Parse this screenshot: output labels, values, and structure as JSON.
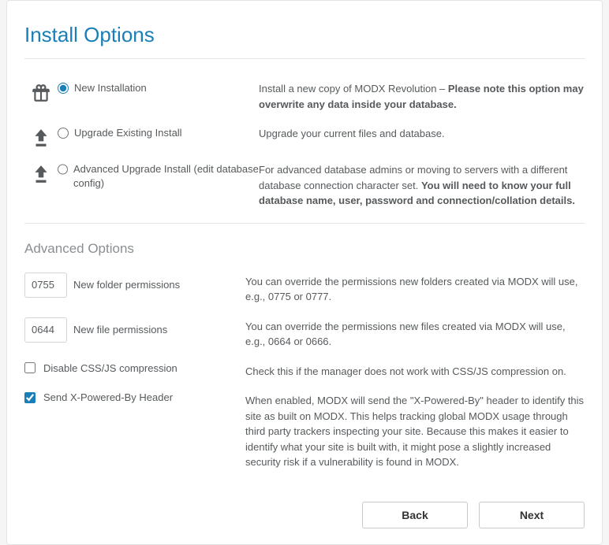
{
  "page_title": "Install Options",
  "install_options": [
    {
      "icon": "gift",
      "label": "New Installation",
      "checked": true,
      "desc_pre": "Install a new copy of MODX Revolution – ",
      "desc_bold": "Please note this option may overwrite any data inside your database."
    },
    {
      "icon": "upgrade",
      "label": "Upgrade Existing Install",
      "checked": false,
      "desc_pre": "Upgrade your current files and database.",
      "desc_bold": ""
    },
    {
      "icon": "upgrade",
      "label": "Advanced Upgrade Install (edit database config)",
      "checked": false,
      "desc_pre": "For advanced database admins or moving to servers with a different database connection character set. ",
      "desc_bold": "You will need to know your full database name, user, password and connection/collation details."
    }
  ],
  "advanced_title": "Advanced Options",
  "advanced": {
    "folder_perm": {
      "value": "0755",
      "label": "New folder permissions",
      "desc": "You can override the permissions new folders created via MODX will use, e.g., 0775 or 0777."
    },
    "file_perm": {
      "value": "0644",
      "label": "New file permissions",
      "desc": "You can override the permissions new files created via MODX will use, e.g., 0664 or 0666."
    },
    "disable_compress": {
      "checked": false,
      "label": "Disable CSS/JS compression",
      "desc": "Check this if the manager does not work with CSS/JS compression on."
    },
    "send_header": {
      "checked": true,
      "label": "Send X-Powered-By Header",
      "desc": "When enabled, MODX will send the \"X-Powered-By\" header to identify this site as built on MODX. This helps tracking global MODX usage through third party trackers inspecting your site. Because this makes it easier to identify what your site is built with, it might pose a slightly increased security risk if a vulnerability is found in MODX."
    }
  },
  "buttons": {
    "back": "Back",
    "next": "Next"
  }
}
